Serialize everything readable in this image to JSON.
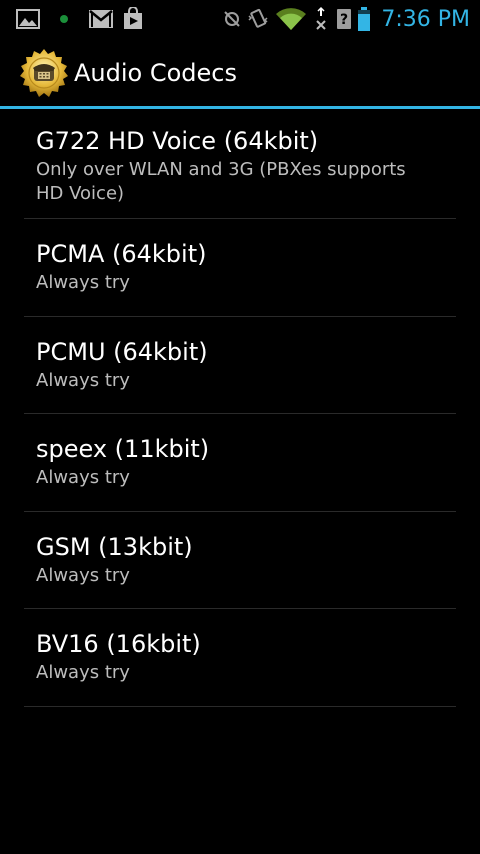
{
  "status_bar": {
    "icons_left": [
      "picture-icon",
      "notification-dot-icon",
      "gmail-icon",
      "play-store-icon"
    ],
    "icons_right": [
      "sync-off-icon",
      "vibrate-icon",
      "wifi-icon",
      "data-icon",
      "unknown-sim-icon",
      "battery-icon"
    ],
    "time": "7:36 PM",
    "accent_color": "#33b5e5",
    "wifi_color": "#8bc34a"
  },
  "action_bar": {
    "title": "Audio Codecs",
    "icon": "phone-seal-icon"
  },
  "codecs": [
    {
      "name": "G722 HD Voice (64kbit)",
      "description": "Only over WLAN and 3G (PBXes supports HD Voice)"
    },
    {
      "name": "PCMA (64kbit)",
      "description": "Always try"
    },
    {
      "name": "PCMU (64kbit)",
      "description": "Always try"
    },
    {
      "name": "speex (11kbit)",
      "description": "Always try"
    },
    {
      "name": "GSM (13kbit)",
      "description": "Always try"
    },
    {
      "name": "BV16 (16kbit)",
      "description": "Always try"
    }
  ]
}
